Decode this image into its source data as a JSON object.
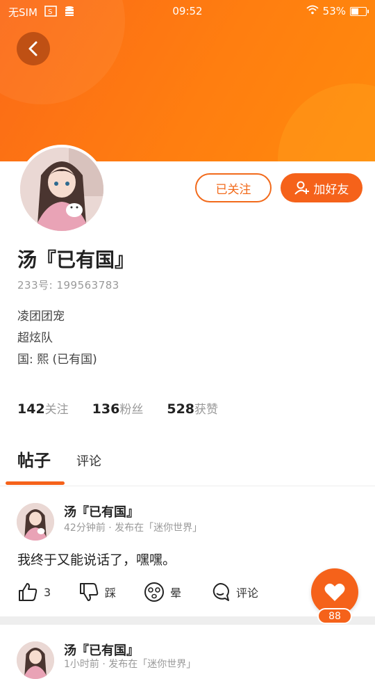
{
  "status_bar": {
    "carrier": "无SIM",
    "time": "09:52",
    "battery": "53%",
    "battery_level": 0.53
  },
  "profile": {
    "follow_button": "已关注",
    "add_friend_button": "加好友",
    "name": "汤『已有国』",
    "id_line": "233号: 199563783",
    "bio_lines": [
      "凌团团宠",
      "超炫队",
      "国: 熙 (已有国)"
    ],
    "stats": [
      {
        "value": "142",
        "label": "关注"
      },
      {
        "value": "136",
        "label": "粉丝"
      },
      {
        "value": "528",
        "label": "获赞"
      }
    ]
  },
  "tabs": [
    {
      "label": "帖子",
      "active": true
    },
    {
      "label": "评论",
      "active": false
    }
  ],
  "posts": [
    {
      "author": "汤『已有国』",
      "meta": "42分钟前 · 发布在「迷你世界」",
      "text": "我终于又能说话了，嘿嘿。",
      "actions": {
        "like": "3",
        "dislike": "踩",
        "emoji": "晕",
        "comment": "评论"
      }
    },
    {
      "author": "汤『已有国』",
      "meta": "1小时前 · 发布在「迷你世界」"
    }
  ],
  "fab": {
    "count": "88"
  },
  "colors": {
    "accent": "#f5621a",
    "header": "#ff7e10"
  }
}
